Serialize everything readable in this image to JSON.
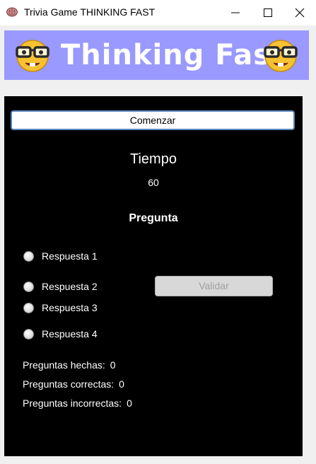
{
  "window": {
    "title": "Trivia Game THINKING FAST",
    "app_icon": "brain-icon",
    "controls": [
      "minimize-icon",
      "maximize-icon",
      "close-icon"
    ]
  },
  "banner": {
    "title": "Thinking Fast",
    "background": "#9999ff",
    "emoji": "nerd-face"
  },
  "game": {
    "start_label": "Comenzar",
    "time_label": "Tiempo",
    "time_value": "60",
    "question": "Pregunta",
    "answers": [
      "Respuesta 1",
      "Respuesta 2",
      "Respuesta 3",
      "Respuesta 4"
    ],
    "validate_label": "Validar",
    "validate_enabled": false
  },
  "stats": {
    "asked_label": "Preguntas hechas:",
    "asked_value": "0",
    "correct_label": "Preguntas correctas:",
    "correct_value": "0",
    "wrong_label": "Preguntas incorrectas:",
    "wrong_value": "0"
  },
  "colors": {
    "panel": "#000000",
    "start_border": "#5b86bd",
    "disabled_button": "#d8d8d8"
  }
}
